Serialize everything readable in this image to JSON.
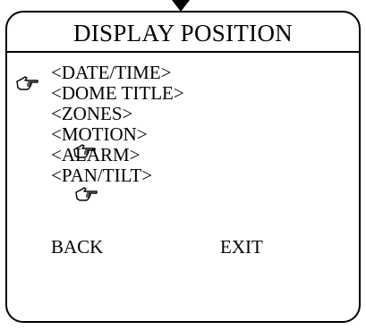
{
  "title": "DISPLAY POSITION",
  "menu": {
    "items": [
      {
        "label": "<DATE/TIME>"
      },
      {
        "label": "<DOME TITLE>"
      },
      {
        "label": "<ZONES>"
      },
      {
        "label": "<MOTION>"
      },
      {
        "label": "<ALARM>"
      },
      {
        "label": "<PAN/TILT>"
      }
    ]
  },
  "footer": {
    "back_label": "BACK",
    "exit_label": "EXIT"
  },
  "icons": {
    "cursor": "pointing-hand-icon",
    "top_marker": "down-arrow-icon"
  },
  "colors": {
    "background": "#ffffff",
    "foreground": "#000000"
  }
}
